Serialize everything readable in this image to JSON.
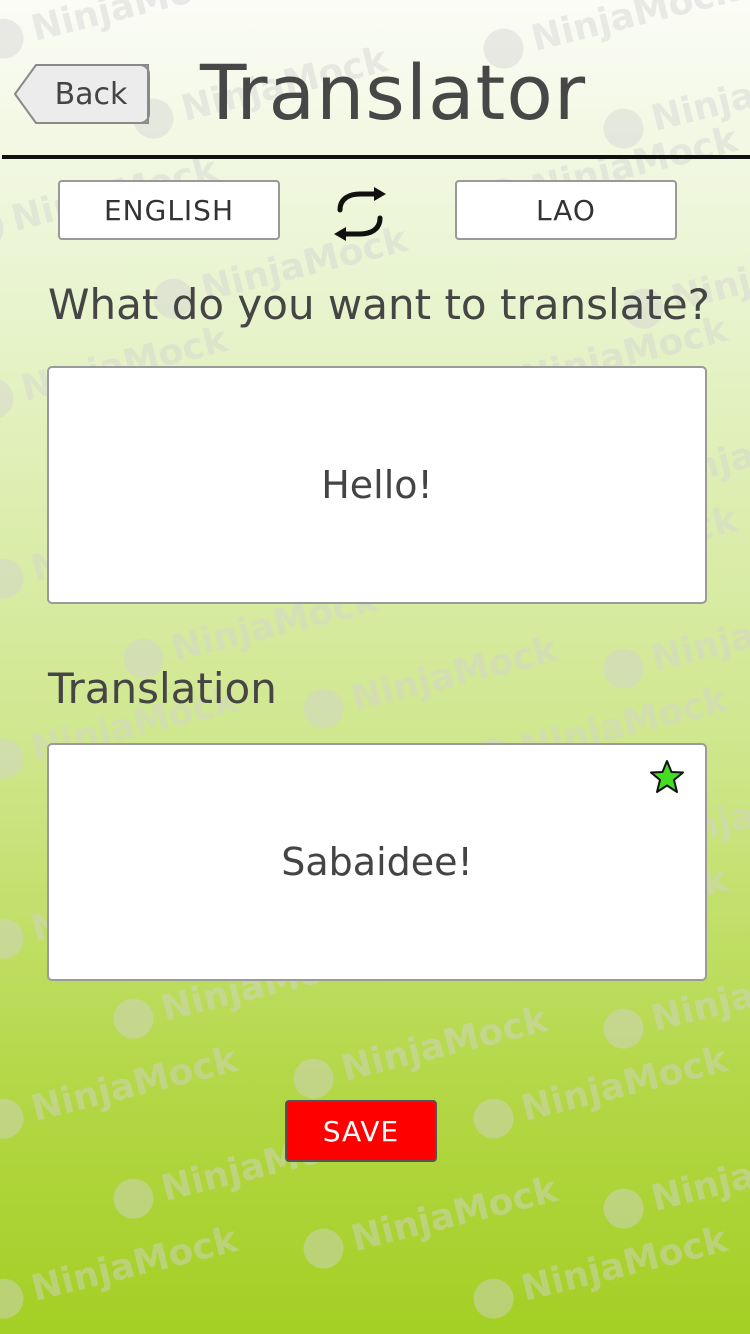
{
  "header": {
    "back_label": "Back",
    "title": "Translator"
  },
  "languages": {
    "source": "ENGLISH",
    "target": "LAO",
    "swap_icon": "swap-arrows-icon"
  },
  "input": {
    "label": "What do you want to translate?",
    "text": "Hello!"
  },
  "output": {
    "label": "Translation",
    "text": "Sabaidee!",
    "favorite_icon": "star-icon",
    "favorite_color": "#44dd22"
  },
  "actions": {
    "save_label": "SAVE",
    "save_color": "#ff0000"
  },
  "watermark": {
    "text": "NinjaMock"
  },
  "theme": {
    "gradient_top": "#fbfcf6",
    "gradient_bottom": "#a4cf24"
  }
}
